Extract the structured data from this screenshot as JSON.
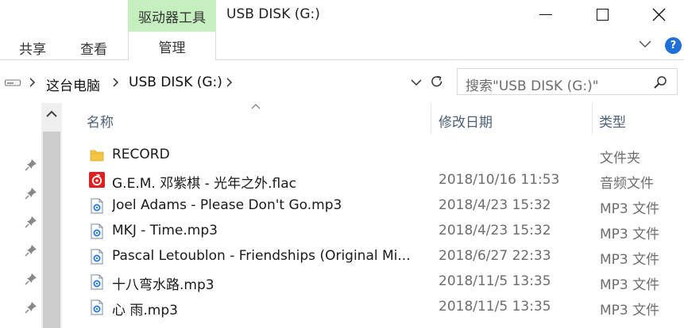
{
  "window": {
    "title": "USB DISK (G:)",
    "context_tab_label": "驱动器工具"
  },
  "ribbon": {
    "tabs": [
      "共享",
      "查看",
      "管理"
    ],
    "help_label": "?"
  },
  "address": {
    "breadcrumbs": [
      "这台电脑",
      "USB DISK (G:)"
    ],
    "search_placeholder": "搜索\"USB DISK (G:)\""
  },
  "columns": {
    "name": "名称",
    "date": "修改日期",
    "type": "类型"
  },
  "files": [
    {
      "name": "RECORD",
      "date": "",
      "type": "文件夹",
      "icon": "folder-icon"
    },
    {
      "name": "G.E.M. 邓紫棋 - 光年之外.flac",
      "date": "2018/10/16 11:53",
      "type": "音频文件",
      "icon": "netease-music-icon"
    },
    {
      "name": "Joel Adams - Please Don't Go.mp3",
      "date": "2018/4/23 15:32",
      "type": "MP3 文件",
      "icon": "audio-file-icon"
    },
    {
      "name": "MKJ - Time.mp3",
      "date": "2018/4/23 15:32",
      "type": "MP3 文件",
      "icon": "audio-file-icon"
    },
    {
      "name": "Pascal Letoublon - Friendships (Original Mi...",
      "date": "2018/6/27 22:33",
      "type": "MP3 文件",
      "icon": "audio-file-icon"
    },
    {
      "name": "十八弯水路.mp3",
      "date": "2018/11/5 13:35",
      "type": "MP3 文件",
      "icon": "audio-file-icon"
    },
    {
      "name": "心 雨.mp3",
      "date": "2018/11/5 13:35",
      "type": "MP3 文件",
      "icon": "audio-file-icon"
    }
  ],
  "colors": {
    "context_tab": "#c6efc0",
    "header_text": "#4c607a",
    "help": "#1e6fd9",
    "netease_red": "#e02020",
    "folder": "#f4c542"
  }
}
